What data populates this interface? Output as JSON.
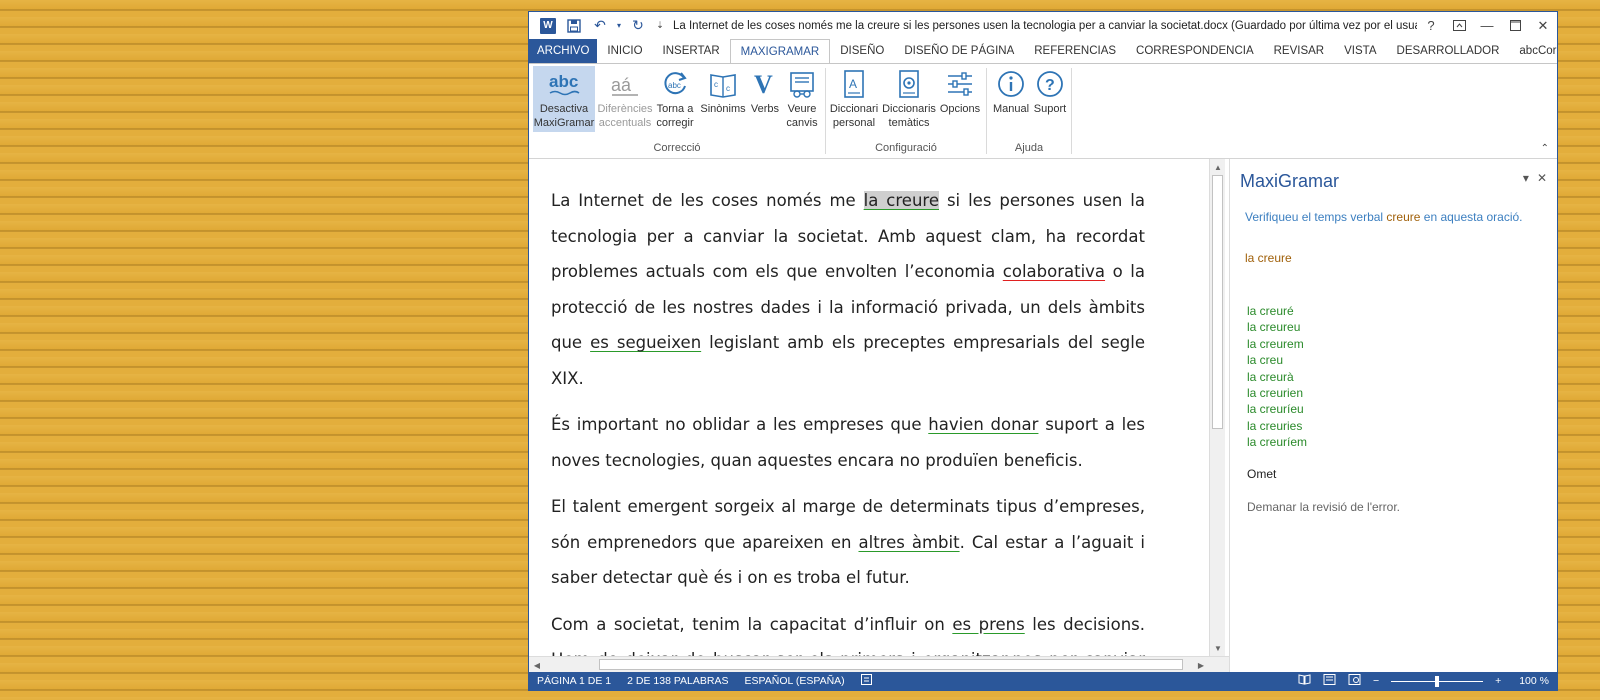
{
  "window": {
    "title": "La Internet de les coses només me la creure si les persones usen la tecnologia per a canviar la societat.docx (Guardado por última vez por el usuario) -...",
    "help": "?"
  },
  "tabs": [
    "ARCHIVO",
    "INICIO",
    "INSERTAR",
    "MAXIGRAMAR",
    "DISEÑO",
    "DISEÑO DE PÁGINA",
    "REFERENCIAS",
    "CORRESPONDENCIA",
    "REVISAR",
    "VISTA",
    "DESARROLLADOR",
    "abcCorrectc"
  ],
  "ribbon": {
    "correccio": {
      "label": "Correcció",
      "desactiva": [
        "Desactiva",
        "MaxiGramar"
      ],
      "diferencies": [
        "Diferències",
        "accentuals"
      ],
      "torna": [
        "Torna a",
        "corregir"
      ],
      "sinonims": "Sinònims",
      "verbs": "Verbs",
      "veure": [
        "Veure",
        "canvis"
      ]
    },
    "configuracio": {
      "label": "Configuració",
      "personal": [
        "Diccionari",
        "personal"
      ],
      "tematics": [
        "Diccionaris",
        "temàtics"
      ],
      "opcions": "Opcions"
    },
    "ajuda": {
      "label": "Ajuda",
      "manual": "Manual",
      "suport": "Suport"
    }
  },
  "document": {
    "p1": {
      "a": "La Internet de les coses només me ",
      "err1": "la creure",
      "b": " si les persones usen la tecnologia per a canviar la societat. Amb aquest clam, ha recordat problemes actuals com els que envolten l’economia ",
      "err2": "colaborativa",
      "c": " o la protecció de les nostres dades i la informació privada, un dels àmbits que ",
      "err3": "es segueixen",
      "d": " legislant amb els preceptes empresarials del segle XIX."
    },
    "p2": {
      "a": "És important no oblidar a les empreses que ",
      "err1": "havien donar",
      "b": " suport a les noves tecnologies, quan aquestes encara no  produïen beneficis."
    },
    "p3": {
      "a": "El talent emergent sorgeix al marge de determinats tipus d’empreses, són emprenedors que apareixen en ",
      "err1": "altres àmbit",
      "b": ". Cal estar a l’aguait i saber detectar què és i on es troba el futur."
    },
    "p4": {
      "a": "Com a societat, tenim la capacitat d’influir on ",
      "err1": "es prens",
      "b": " les decisions. Hem de deixar de buscar ser els primers  i organitzar-nos per canviar les coses."
    }
  },
  "pane": {
    "title": "MaxiGramar",
    "message_before": "Verifiqueu el temps verbal ",
    "message_verb": "creure",
    "message_after": " en aquesta oració.",
    "current": "la creure",
    "suggestions": [
      "la creuré",
      "la creureu",
      "la creurem",
      "la creu",
      "la creurà",
      "la creurien",
      "la creuríeu",
      "la creuries",
      "la creuríem"
    ],
    "omit": "Omet",
    "review": "Demanar la revisió de l'error."
  },
  "statusbar": {
    "page": "PÁGINA 1 DE 1",
    "words": "2 DE 138 PALABRAS",
    "language": "ESPAÑOL (ESPAÑA)",
    "zoom": "100 %",
    "zoom_level": 0.5
  },
  "colors": {
    "accent": "#2b579a",
    "grammar_underline": "#2a9a2a",
    "spelling_underline": "#e02020"
  }
}
